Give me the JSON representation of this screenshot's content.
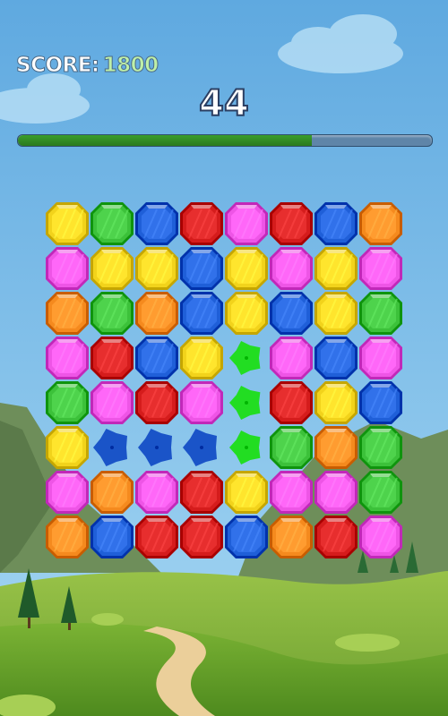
{
  "hud": {
    "score_label": "SCORE:",
    "score_value": "1800",
    "timer": "44",
    "time_progress": 0.71
  },
  "colors": {
    "yellow": "#f2d31b",
    "green": "#3cc13a",
    "blue": "#1f5fd8",
    "red": "#d51c1c",
    "pink": "#ee55e6",
    "orange": "#f58a1e",
    "splash_green": "#22dd22",
    "splash_blue": "#1a54c8"
  },
  "board": {
    "rows": 8,
    "cols": 8,
    "cells": [
      [
        "yellow",
        "green",
        "blue",
        "red",
        "pink",
        "red",
        "blue",
        "orange"
      ],
      [
        "pink",
        "yellow",
        "yellow",
        "blue",
        "yellow",
        "pink",
        "yellow",
        "pink"
      ],
      [
        "orange",
        "green",
        "orange",
        "blue",
        "yellow",
        "blue",
        "yellow",
        "green"
      ],
      [
        "pink",
        "red",
        "blue",
        "yellow",
        "splash-green",
        "pink",
        "blue",
        "pink"
      ],
      [
        "green",
        "pink",
        "red",
        "pink",
        "splash-green",
        "red",
        "yellow",
        "blue"
      ],
      [
        "yellow",
        "splash-blue",
        "splash-blue",
        "splash-blue",
        "splash-green",
        "green",
        "orange",
        "green"
      ],
      [
        "pink",
        "orange",
        "pink",
        "red",
        "yellow",
        "pink",
        "pink",
        "green"
      ],
      [
        "orange",
        "blue",
        "red",
        "red",
        "blue",
        "orange",
        "red",
        "pink"
      ]
    ]
  }
}
